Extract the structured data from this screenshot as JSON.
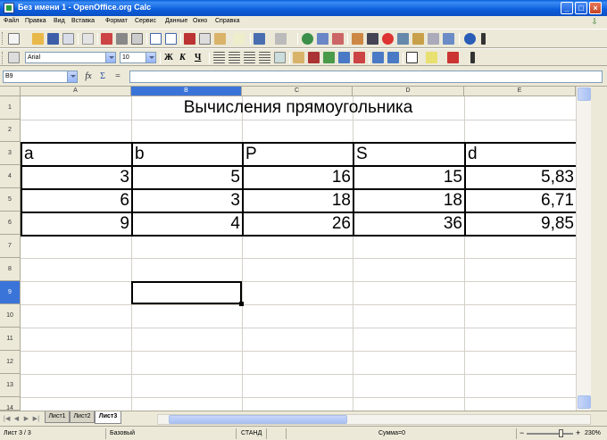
{
  "window": {
    "title": "Без имени 1 - OpenOffice.org Calc",
    "minimize": "_",
    "maximize": "□",
    "close": "×"
  },
  "menu": {
    "items": [
      "Файл",
      "Правка",
      "Вид",
      "Вставка",
      "Формат",
      "Сервис",
      "Данные",
      "Окно",
      "Справка"
    ]
  },
  "format_toolbar": {
    "font_name": "Arial",
    "font_size": "10",
    "bold": "Ж",
    "italic": "К",
    "underline": "Ч"
  },
  "formula_bar": {
    "name_box": "B9",
    "function_wizard": "fx",
    "sum": "Σ",
    "equals": "="
  },
  "grid": {
    "columns": [
      "A",
      "B",
      "C",
      "D",
      "E"
    ],
    "rows": [
      "1",
      "2",
      "3",
      "4",
      "5",
      "6",
      "7",
      "8",
      "9",
      "10",
      "11",
      "12",
      "13",
      "14"
    ],
    "selected_column": "B",
    "selected_row": "9",
    "title": "Вычисления прямоугольника",
    "table_headers": [
      "a",
      "b",
      "P",
      "S",
      "d"
    ],
    "table_rows": [
      [
        "3",
        "5",
        "16",
        "15",
        "5,83"
      ],
      [
        "6",
        "3",
        "18",
        "18",
        "6,71"
      ],
      [
        "9",
        "4",
        "26",
        "36",
        "9,85"
      ]
    ]
  },
  "sheets": {
    "tabs": [
      "Лист1",
      "Лист2",
      "Лист3"
    ],
    "active": "Лист3"
  },
  "status": {
    "sheet": "Лист 3 / 3",
    "style": "Базовый",
    "mode": "СТАНД",
    "sum": "Сумма=0",
    "zoom": "230%"
  },
  "colors": {
    "titlebar": "#0a5fd8",
    "selected_header": "#3a74d8",
    "toolbar_bg": "#ece9d8"
  }
}
